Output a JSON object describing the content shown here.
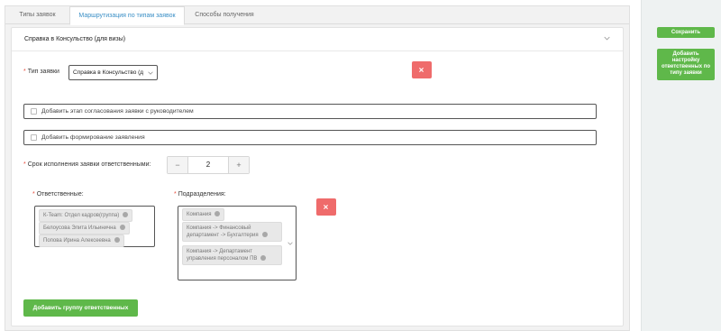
{
  "tabs": [
    {
      "label": "Типы заявок"
    },
    {
      "label": "Маршрутизация по типам заявок"
    },
    {
      "label": "Способы получения"
    }
  ],
  "card": {
    "title": "Справка в Консульство (для визы)",
    "request_type": {
      "label": "Тип заявки",
      "value": "Справка в Консульство (д"
    },
    "checkboxes": [
      {
        "label": "Добавить этап согласования заявки с руководителем",
        "checked": false
      },
      {
        "label": "Добавить формирование заявления",
        "checked": false
      }
    ],
    "deadline": {
      "label": "Срок исполнения заявки ответственными:",
      "value": "2",
      "minus": "−",
      "plus": "+"
    },
    "responsible": {
      "label": "Ответственные:",
      "tags": [
        "К-Team: Отдел кадров(группа)",
        "Белоусова Элита Ильинична",
        "Попова Ирина Алексеевна"
      ]
    },
    "departments": {
      "label": "Подразделения:",
      "tags": [
        "Компания",
        "Компания -> Финансовый департамент -> Бухгалтерия",
        "Компания -> Департамент управления персоналом ПВ"
      ]
    },
    "add_group_label": "Добавить группу ответственных"
  },
  "sidebar": {
    "save_label": "Сохранить",
    "add_setting_label": "Добавить настройку ответственных по типу заявки"
  },
  "colors": {
    "accent_green": "#5fb84a",
    "danger_red": "#ef6b6b",
    "active_tab": "#3a8fc6"
  },
  "icons": {
    "close": "close-icon",
    "chevron": "chevron-down-icon",
    "tag_remove": "tag-remove-icon"
  }
}
